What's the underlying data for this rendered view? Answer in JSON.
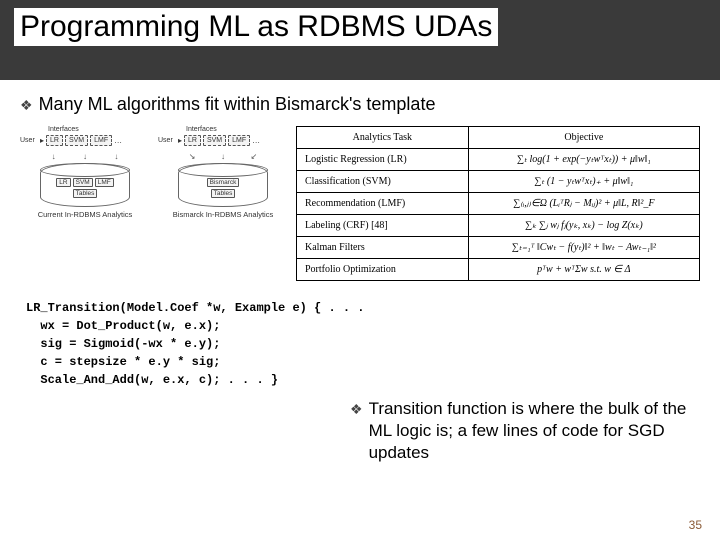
{
  "title": "Programming ML as RDBMS UDAs",
  "bullet1": "Many ML algorithms fit within Bismarck's template",
  "bullet2": "Transition function is where the bulk of the ML logic is; a few lines of code for SGD updates",
  "page_number": "35",
  "arch": {
    "interfaces_label": "Interfaces",
    "user_label": "User",
    "chips": {
      "lr": "LR",
      "svm": "SVM",
      "lmf": "LMF",
      "dots": "…",
      "bismarck": "Bismarck",
      "tables": "Tables"
    },
    "caption_left": "Current In-RDBMS Analytics",
    "caption_right": "Bismarck In-RDBMS Analytics"
  },
  "table": {
    "headers": {
      "task": "Analytics Task",
      "objective": "Objective"
    },
    "rows": [
      {
        "task": "Logistic Regression (LR)",
        "obj": "∑ₜ log(1 + exp(−yₜwᵀxₜ)) + μ‖w‖₁"
      },
      {
        "task": "Classification (SVM)",
        "obj": "∑ₜ (1 − yₜwᵀxₜ)₊ + μ‖w‖₁"
      },
      {
        "task": "Recommendation (LMF)",
        "obj": "∑₍ᵢ,ⱼ₎∈Ω (LᵢᵀRⱼ − Mᵢⱼ)² + μ‖L, R‖²_F"
      },
      {
        "task": "Labeling (CRF) [48]",
        "obj": "∑ₖ ∑ⱼ wⱼ fⱼ(yₖ, xₖ) − log Z(xₖ)"
      },
      {
        "task": "Kalman Filters",
        "obj": "∑ₜ₌₁ᵀ ‖Cwₜ − f(yₜ)‖² + ‖wₜ − Awₜ₋₁‖²"
      },
      {
        "task": "Portfolio Optimization",
        "obj": "pᵀw + wᵀΣw   s.t.  w ∈ Δ"
      }
    ]
  },
  "code": {
    "l1": "LR_Transition(Model.Coef *w, Example e) { . . .",
    "l2": "  wx = Dot_Product(w, e.x);",
    "l3": "  sig = Sigmoid(-wx * e.y);",
    "l4": "  c = stepsize * e.y * sig;",
    "l5": "  Scale_And_Add(w, e.x, c); . . . }"
  }
}
